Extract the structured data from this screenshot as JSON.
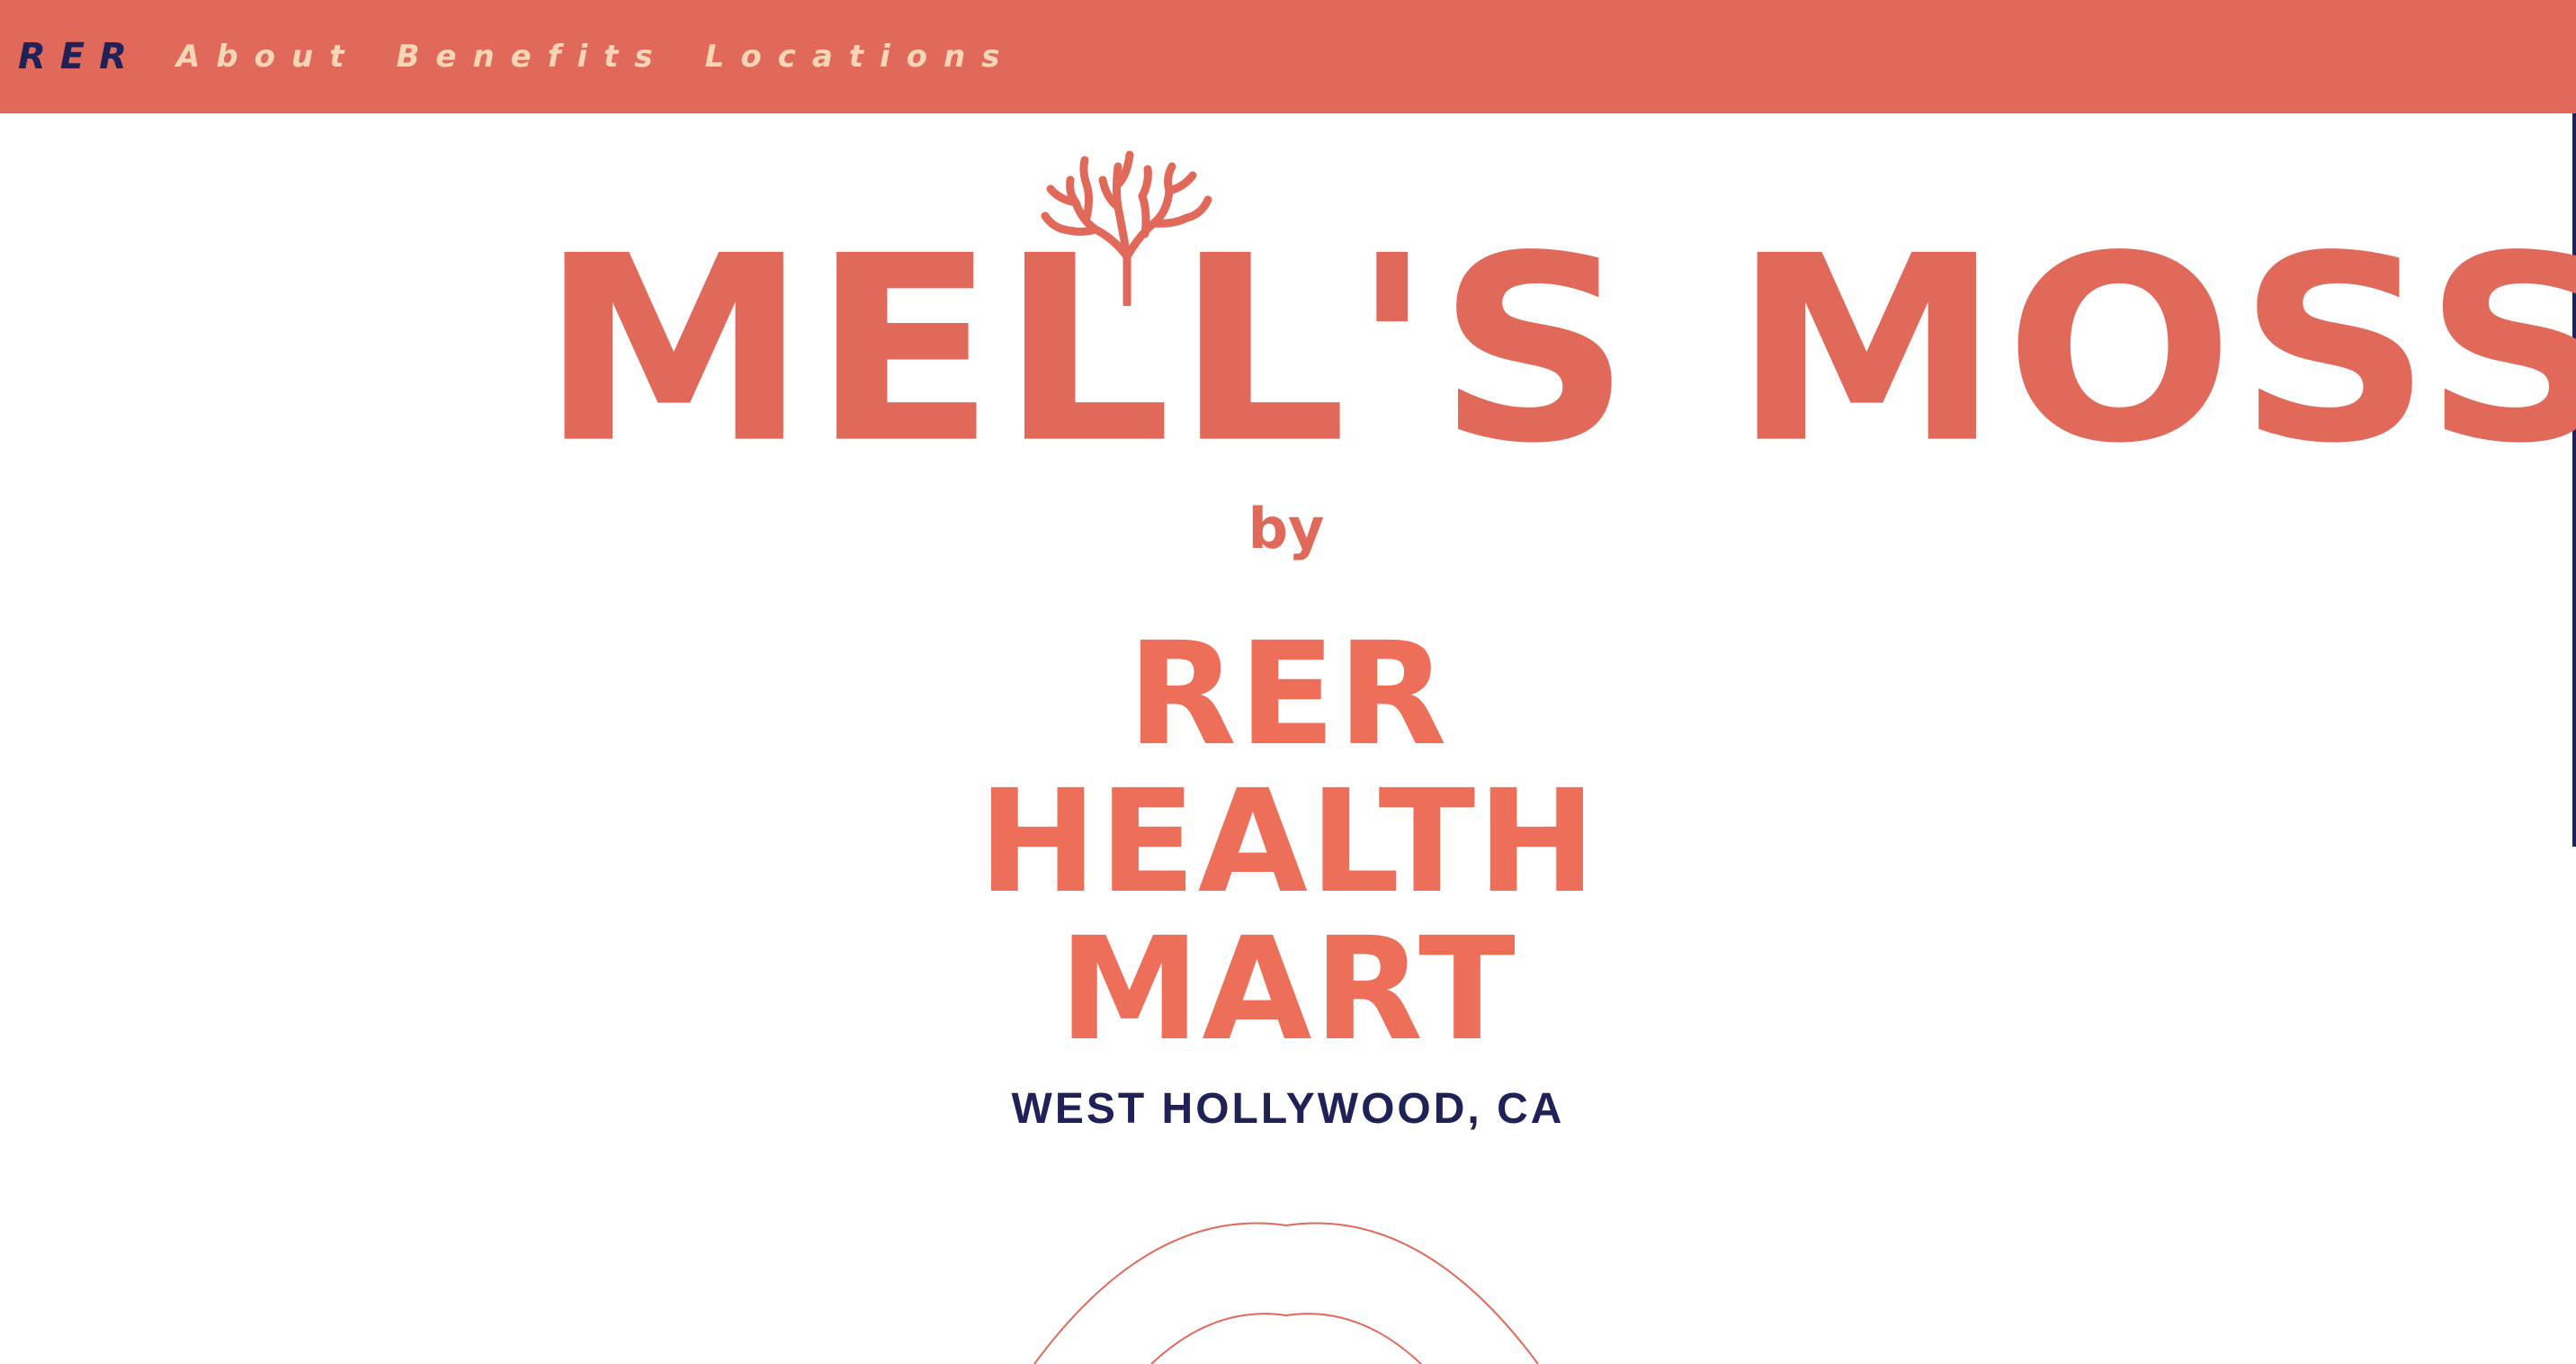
{
  "nav": {
    "brand": "RER",
    "links": [
      "About",
      "Benefits",
      "Locations"
    ]
  },
  "hero": {
    "brand_name": "MELL'S MOSS",
    "by": "by",
    "store_lines": [
      "RER",
      "HEALTH",
      "MART"
    ],
    "location": "WEST HOLLYWOOD, CA"
  },
  "icons": {
    "logo_ornament": "coral-icon"
  },
  "colors": {
    "nav_background": "#e16959",
    "nav_link": "#f6d6b7",
    "brand_navy": "#1f2157",
    "coral": "#e16959",
    "store_coral": "#ee6f59"
  }
}
